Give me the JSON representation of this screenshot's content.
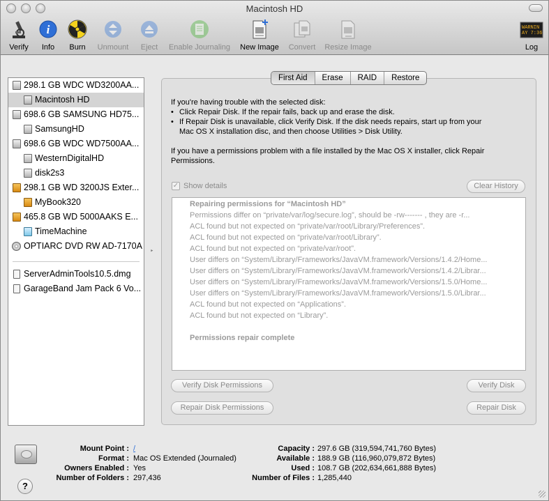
{
  "window": {
    "title": "Macintosh HD"
  },
  "toolbar": {
    "items": [
      {
        "label": "Verify",
        "icon": "microscope-icon",
        "enabled": true
      },
      {
        "label": "Info",
        "icon": "info-icon",
        "enabled": true
      },
      {
        "label": "Burn",
        "icon": "burn-icon",
        "enabled": true
      },
      {
        "label": "Unmount",
        "icon": "unmount-icon",
        "enabled": false
      },
      {
        "label": "Eject",
        "icon": "eject-icon",
        "enabled": false
      },
      {
        "label": "Enable Journaling",
        "icon": "journal-icon",
        "enabled": false
      },
      {
        "label": "New Image",
        "icon": "new-image-icon",
        "enabled": true
      },
      {
        "label": "Convert",
        "icon": "convert-icon",
        "enabled": false
      },
      {
        "label": "Resize Image",
        "icon": "resize-image-icon",
        "enabled": false
      }
    ],
    "log": {
      "label": "Log",
      "icon": "console-log-icon",
      "icon_text_1": "WARNIN",
      "icon_text_2": "AY 7:36"
    }
  },
  "sidebar": {
    "items": [
      {
        "label": "298.1 GB WDC WD3200AA...",
        "level": 0,
        "kind": "disk"
      },
      {
        "label": "Macintosh HD",
        "level": 1,
        "kind": "volume",
        "selected": true
      },
      {
        "label": "698.6 GB SAMSUNG HD75...",
        "level": 0,
        "kind": "disk"
      },
      {
        "label": "SamsungHD",
        "level": 1,
        "kind": "volume"
      },
      {
        "label": "698.6 GB WDC WD7500AA...",
        "level": 0,
        "kind": "disk"
      },
      {
        "label": "WesternDigitalHD",
        "level": 1,
        "kind": "volume"
      },
      {
        "label": "disk2s3",
        "level": 1,
        "kind": "volume"
      },
      {
        "label": "298.1 GB WD 3200JS Exter...",
        "level": 0,
        "kind": "external"
      },
      {
        "label": "MyBook320",
        "level": 1,
        "kind": "external"
      },
      {
        "label": "465.8 GB WD 5000AAKS E...",
        "level": 0,
        "kind": "external"
      },
      {
        "label": "TimeMachine",
        "level": 1,
        "kind": "timemachine"
      },
      {
        "label": "OPTIARC DVD RW AD-7170A",
        "level": 0,
        "kind": "optical"
      },
      {
        "label": "ServerAdminTools10.5.dmg",
        "level": 0,
        "kind": "image"
      },
      {
        "label": "GarageBand Jam Pack 6 Vo...",
        "level": 0,
        "kind": "image"
      }
    ]
  },
  "tabs": [
    "First Aid",
    "Erase",
    "RAID",
    "Restore"
  ],
  "first_aid": {
    "intro": "If you're having trouble with the selected disk:",
    "bullet1": "Click Repair Disk. If the repair fails, back up and erase the disk.",
    "bullet2a": "If Repair Disk is unavailable, click Verify Disk. If the disk needs repairs, start up from your",
    "bullet2b": "Mac OS X installation disc, and then choose Utilities > Disk Utility.",
    "perm_a": "If you have a permissions problem with a file installed by the Mac OS X installer, click Repair",
    "perm_b": "Permissions.",
    "show_details": "Show details",
    "clear_history": "Clear History",
    "log_lines": [
      {
        "text": "Repairing permissions for “Macintosh HD”",
        "bold": true
      },
      {
        "text": "Permissions differ on “private/var/log/secure.log”, should be -rw------- , they are -r...",
        "bold": false
      },
      {
        "text": "ACL found but not expected on “private/var/root/Library/Preferences”.",
        "bold": false
      },
      {
        "text": "ACL found but not expected on “private/var/root/Library”.",
        "bold": false
      },
      {
        "text": "ACL found but not expected on “private/var/root”.",
        "bold": false
      },
      {
        "text": "User differs on “System/Library/Frameworks/JavaVM.framework/Versions/1.4.2/Home...",
        "bold": false
      },
      {
        "text": "User differs on “System/Library/Frameworks/JavaVM.framework/Versions/1.4.2/Librar...",
        "bold": false
      },
      {
        "text": "User differs on “System/Library/Frameworks/JavaVM.framework/Versions/1.5.0/Home...",
        "bold": false
      },
      {
        "text": "User differs on “System/Library/Frameworks/JavaVM.framework/Versions/1.5.0/Librar...",
        "bold": false
      },
      {
        "text": "ACL found but not expected on “Applications”.",
        "bold": false
      },
      {
        "text": "ACL found but not expected on “Library”.",
        "bold": false
      },
      {
        "text": "",
        "bold": false
      },
      {
        "text": "Permissions repair complete",
        "bold": true
      }
    ],
    "verify_permissions": "Verify Disk Permissions",
    "repair_permissions": "Repair Disk Permissions",
    "verify_disk": "Verify Disk",
    "repair_disk": "Repair Disk"
  },
  "info": {
    "mount_point_label": "Mount Point :",
    "mount_point": "/",
    "format_label": "Format :",
    "format": "Mac OS Extended (Journaled)",
    "owners_label": "Owners Enabled :",
    "owners": "Yes",
    "folders_label": "Number of Folders :",
    "folders": "297,436",
    "capacity_label": "Capacity :",
    "capacity": "297.6 GB (319,594,741,760 Bytes)",
    "available_label": "Available :",
    "available": "188.9 GB (116,960,079,872 Bytes)",
    "used_label": "Used :",
    "used": "108.7 GB (202,634,661,888 Bytes)",
    "files_label": "Number of Files :",
    "files": "1,285,440",
    "help": "?"
  },
  "colors": {
    "accent_blue": "#2f6fd6",
    "selection_gray": "#d4d4d4",
    "disabled_text": "#8a8a8a"
  }
}
